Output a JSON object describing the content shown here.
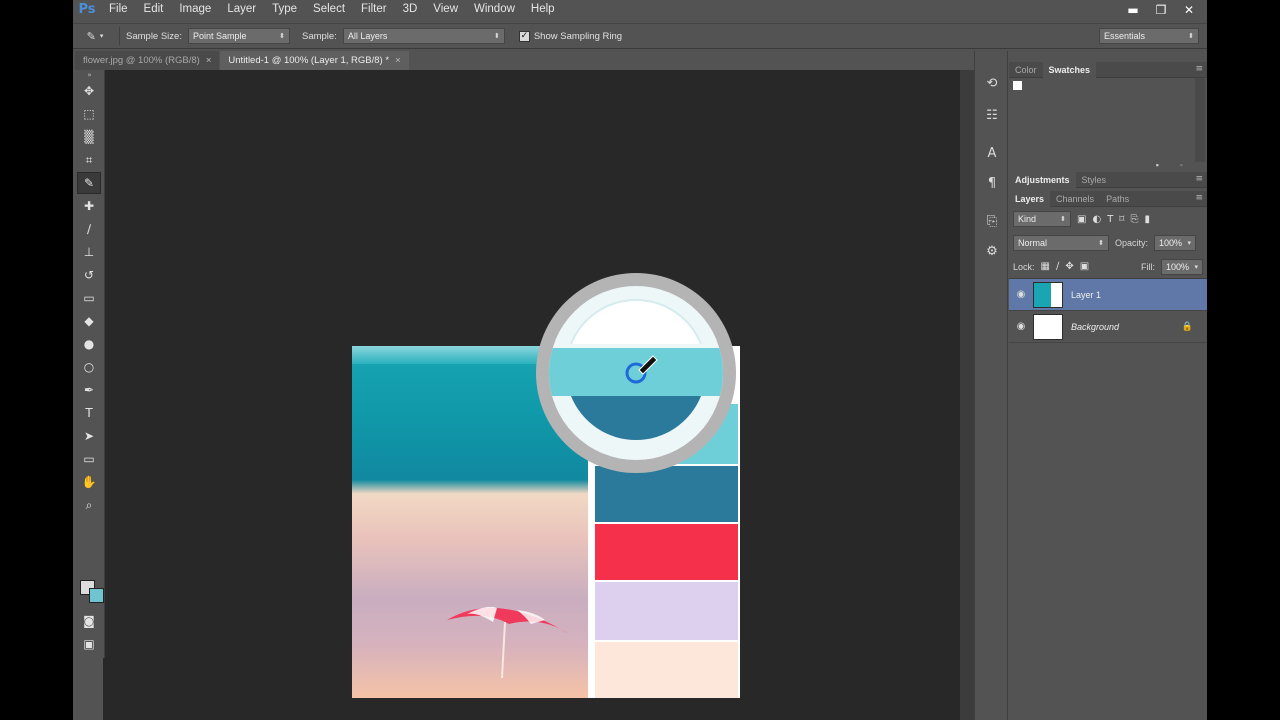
{
  "app": {
    "logo": "Ps"
  },
  "menu": [
    "File",
    "Edit",
    "Image",
    "Layer",
    "Type",
    "Select",
    "Filter",
    "3D",
    "View",
    "Window",
    "Help"
  ],
  "window_controls": {
    "minimize": "▬",
    "restore": "❐",
    "close": "✕"
  },
  "options": {
    "sample_size_label": "Sample Size:",
    "sample_size_value": "Point Sample",
    "sample_label": "Sample:",
    "sample_value": "All Layers",
    "show_ring_label": "Show Sampling Ring",
    "show_ring_checked": true,
    "workspace": "Essentials"
  },
  "tabs": [
    {
      "label": "flower.jpg @ 100% (RGB/8)",
      "active": false
    },
    {
      "label": "Untitled-1 @ 100% (Layer 1, RGB/8) *",
      "active": true
    }
  ],
  "tabs_close_glyph": "×",
  "toolbar": {
    "tools": [
      {
        "name": "move-tool-icon",
        "glyph": "✥"
      },
      {
        "name": "marquee-tool-icon",
        "glyph": "⬚"
      },
      {
        "name": "quick-select-tool-icon",
        "glyph": "▒"
      },
      {
        "name": "crop-tool-icon",
        "glyph": "⌗"
      },
      {
        "name": "eyedropper-tool-icon",
        "glyph": "✎"
      },
      {
        "name": "healing-brush-tool-icon",
        "glyph": "✚"
      },
      {
        "name": "brush-tool-icon",
        "glyph": "∕"
      },
      {
        "name": "stamp-tool-icon",
        "glyph": "⊥"
      },
      {
        "name": "history-brush-tool-icon",
        "glyph": "↺"
      },
      {
        "name": "eraser-tool-icon",
        "glyph": "▭"
      },
      {
        "name": "paint-bucket-tool-icon",
        "glyph": "◆"
      },
      {
        "name": "blur-tool-icon",
        "glyph": "●"
      },
      {
        "name": "dodge-tool-icon",
        "glyph": "○"
      },
      {
        "name": "pen-tool-icon",
        "glyph": "✒"
      },
      {
        "name": "type-tool-icon",
        "glyph": "T"
      },
      {
        "name": "path-select-tool-icon",
        "glyph": "➤"
      },
      {
        "name": "rectangle-tool-icon",
        "glyph": "▭"
      },
      {
        "name": "hand-tool-icon",
        "glyph": "✋"
      },
      {
        "name": "zoom-tool-icon",
        "glyph": "⌕"
      }
    ],
    "active_tool": "eyedropper-tool-icon",
    "collapse_glyph": "»",
    "quick_mask_glyph": "◙",
    "screen_mode_glyph": "▣",
    "foreground_color": "#dcdcdc",
    "background_color": "#6fc4cf"
  },
  "palette_colors": [
    "#ffffff",
    "#6fcfd9",
    "#2b7a9c",
    "#f4304a",
    "#ddd0ee",
    "#fde6da"
  ],
  "panels": {
    "top_tabs": [
      "Color",
      "Swatches"
    ],
    "top_active": "Swatches",
    "adjust_tabs": [
      "Adjustments",
      "Styles"
    ],
    "adjust_active": "Adjustments",
    "layer_tabs": [
      "Layers",
      "Channels",
      "Paths"
    ],
    "layer_active": "Layers",
    "kind_label": "Kind",
    "blend_mode": "Normal",
    "opacity_label": "Opacity:",
    "opacity_value": "100%",
    "lock_label": "Lock:",
    "fill_label": "Fill:",
    "fill_value": "100%",
    "panel_menu_glyph": "≡",
    "eye_glyph": "◉",
    "lock_glyph": "🔒",
    "layers": [
      {
        "name": "Layer 1",
        "selected": true,
        "locked": false
      },
      {
        "name": "Background",
        "selected": false,
        "locked": true
      }
    ]
  },
  "dock_icons": [
    "history-icon",
    "properties-icon",
    "character-icon",
    "paragraph-icon",
    "clone-source-icon",
    "tool-presets-icon"
  ],
  "dock_glyphs": [
    "⟲",
    "☷",
    "A",
    "¶",
    "⎘",
    "⚙"
  ]
}
